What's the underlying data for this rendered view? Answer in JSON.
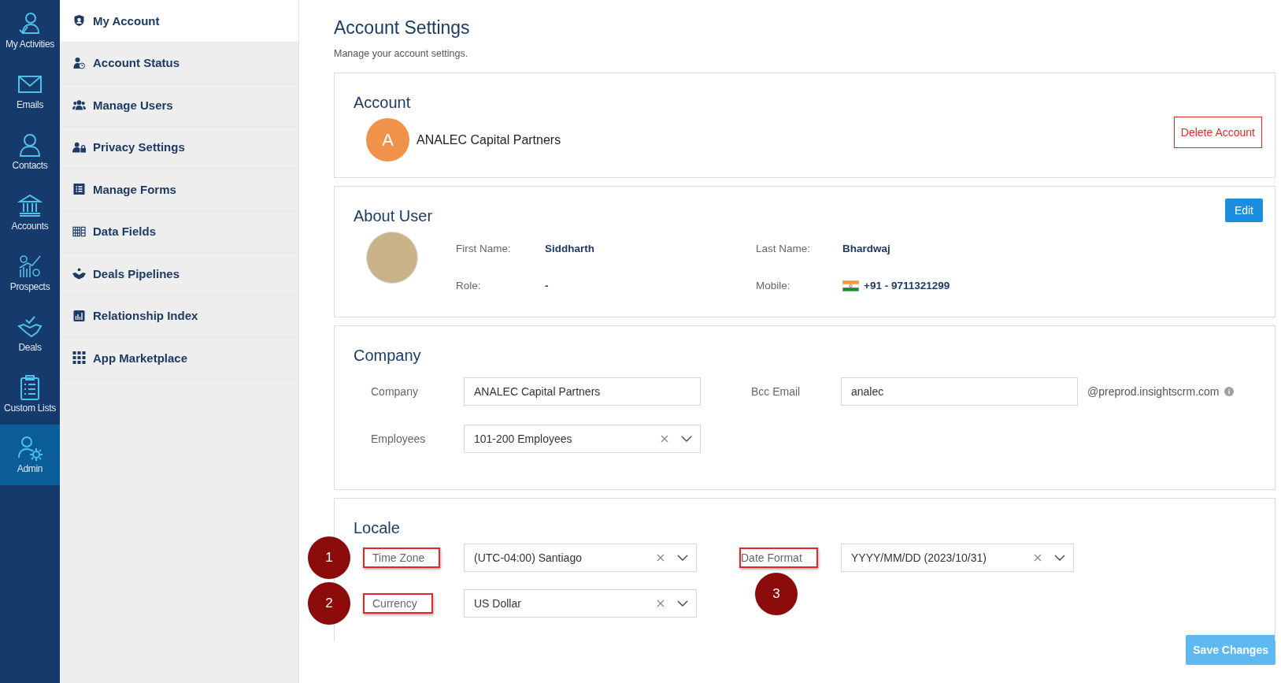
{
  "rail": [
    {
      "label": "My Activities",
      "selected": false
    },
    {
      "label": "Emails",
      "selected": false
    },
    {
      "label": "Contacts",
      "selected": false
    },
    {
      "label": "Accounts",
      "selected": false
    },
    {
      "label": "Prospects",
      "selected": false
    },
    {
      "label": "Deals",
      "selected": false
    },
    {
      "label": "Custom Lists",
      "selected": false
    },
    {
      "label": "Admin",
      "selected": true
    }
  ],
  "nav": [
    {
      "label": "My Account",
      "selected": true
    },
    {
      "label": "Account Status",
      "selected": false
    },
    {
      "label": "Manage Users",
      "selected": false
    },
    {
      "label": "Privacy Settings",
      "selected": false
    },
    {
      "label": "Manage Forms",
      "selected": false
    },
    {
      "label": "Data Fields",
      "selected": false
    },
    {
      "label": "Deals Pipelines",
      "selected": false
    },
    {
      "label": "Relationship Index",
      "selected": false
    },
    {
      "label": "App Marketplace",
      "selected": false
    }
  ],
  "page": {
    "title": "Account Settings",
    "subtitle": "Manage your account settings."
  },
  "account": {
    "heading": "Account",
    "avatar_letter": "A",
    "name": "ANALEC Capital Partners",
    "delete_button": "Delete Account"
  },
  "about": {
    "heading": "About User",
    "edit_button": "Edit",
    "fields": [
      {
        "label": "First Name:",
        "value": "Siddharth",
        "kind": "plain"
      },
      {
        "label": "Last Name:",
        "value": "Bhardwaj",
        "kind": "plain"
      },
      {
        "label": "Role:",
        "value": "-",
        "kind": "plain"
      },
      {
        "label": "Mobile:",
        "value": "+91 - 9711321299",
        "kind": "phone"
      }
    ]
  },
  "company": {
    "heading": "Company",
    "fields": [
      {
        "label": "Company",
        "kind": "text",
        "value": "ANALEC Capital Partners"
      },
      {
        "label": "Bcc Email",
        "kind": "text",
        "value": "analec",
        "suffix": "@preprod.insightscrm.com"
      },
      {
        "label": "Employees",
        "kind": "select",
        "value": "101-200 Employees"
      }
    ]
  },
  "locale": {
    "heading": "Locale",
    "fields": [
      {
        "label": "Time Zone",
        "kind": "select",
        "value": "(UTC-04:00) Santiago",
        "highlighted": true,
        "callout": "1"
      },
      {
        "label": "Date Format",
        "kind": "select",
        "value": "YYYY/MM/DD (2023/10/31)",
        "highlighted": true,
        "callout": "3"
      },
      {
        "label": "Currency",
        "kind": "select",
        "value": "US Dollar",
        "highlighted": true,
        "callout": "2"
      }
    ]
  },
  "save_button": "Save Changes"
}
